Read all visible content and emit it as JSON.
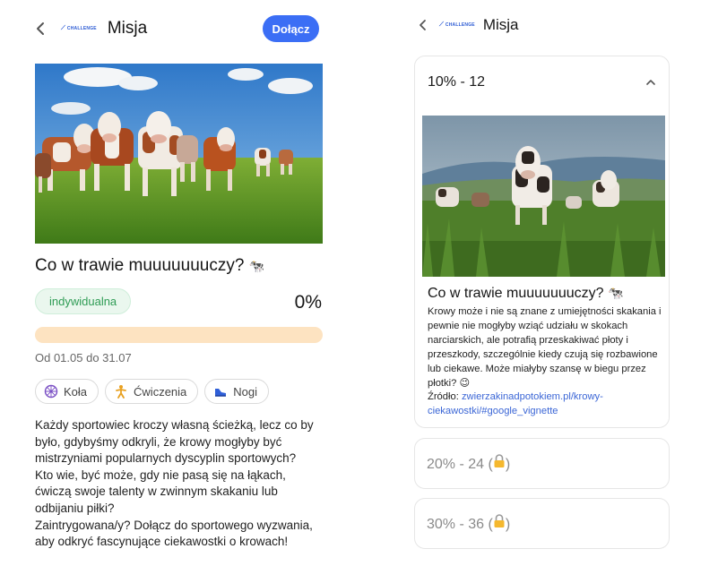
{
  "left": {
    "header": {
      "title": "Misja",
      "logo_text": "CHALLENGE",
      "join_label": "Dołącz"
    },
    "mission": {
      "title": "Co w trawie muuuuuuuczy?",
      "title_emoji": "🐄",
      "type_badge": "indywidualna",
      "progress_text": "0%",
      "progress_value": 0,
      "dates": "Od 01.05 do 31.07",
      "tags": [
        {
          "label": "Koła",
          "icon": "wheel-icon"
        },
        {
          "label": "Ćwiczenia",
          "icon": "exercise-icon"
        },
        {
          "label": "Nogi",
          "icon": "sneaker-icon"
        }
      ],
      "description": [
        "Każdy sportowiec kroczy własną ścieżką, lecz co by było, gdybyśmy odkryli, że krowy mogłyby być mistrzyniami popularnych dyscyplin sportowych?",
        "Kto wie, być może, gdy nie pasą się na łąkach, ćwiczą swoje talenty w zwinnym skakaniu lub odbijaniu piłki?",
        "Zaintrygowana/y? Dołącz do sportowego wyzwania, aby odkryć fascynujące ciekawostki o krowach!"
      ]
    }
  },
  "right": {
    "header": {
      "title": "Misja",
      "logo_text": "CHALLENGE"
    },
    "levels": [
      {
        "label": "10% - 12",
        "expanded": true,
        "title": "Co w trawie muuuuuuuczy?",
        "title_emoji": "🐄",
        "text": "Krowy może i nie są znane z umiejętności skakania i pewnie nie mogłyby wziąć udziału w skokach narciarskich, ale potrafią przeskakiwać płoty i przeszkody, szczególnie kiedy czują się rozbawione lub ciekawe. Może miałyby szansę w biegu przez płotki? 😉",
        "source_label": "Źródło:",
        "source_link": "zwierzakinadpotokiem.pl/krowy-ciekawostki/#google_vignette"
      },
      {
        "label": "20% - 24",
        "locked": true
      },
      {
        "label": "30% - 36",
        "locked": true
      }
    ]
  },
  "colors": {
    "accent": "#3b6ef5",
    "badge_green": "#2f9c55",
    "progress_track": "#fde3c1",
    "link": "#3b66d6",
    "locked_text": "#8a8a8a"
  }
}
